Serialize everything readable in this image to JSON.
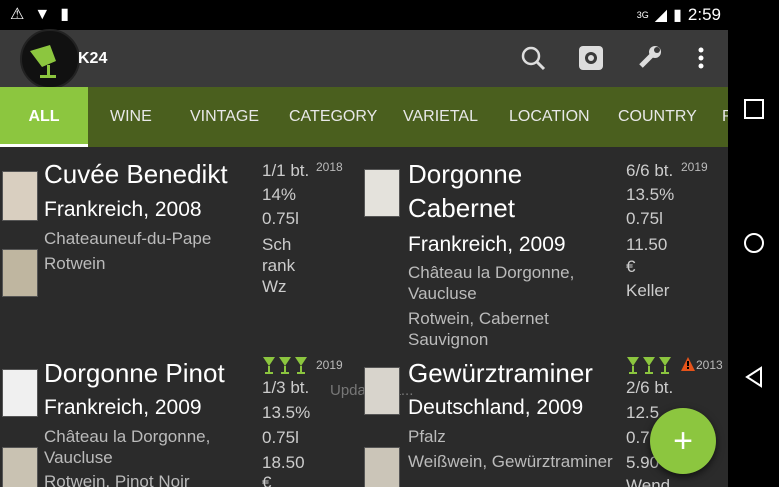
{
  "status": {
    "time": "2:59",
    "network": "3G",
    "icons": [
      "warning-icon",
      "wifi-icon",
      "sd-card-icon"
    ]
  },
  "appbar": {
    "title": "K24",
    "actions": [
      "search-icon",
      "settings-icon",
      "wrench-icon",
      "more-icon"
    ]
  },
  "tabs": [
    {
      "label": "ALL"
    },
    {
      "label": "WINE"
    },
    {
      "label": "VINTAGE"
    },
    {
      "label": "CATEGORY"
    },
    {
      "label": "VARIETAL"
    },
    {
      "label": "LOCATION"
    },
    {
      "label": "COUNTRY"
    },
    {
      "label": "R"
    }
  ],
  "ghost_text": "UpdateSta...",
  "cards": [
    {
      "title": "Cuvée Benedikt",
      "subtitle": "Frankreich, 2008",
      "region": "Chateauneuf-du-Pape",
      "type": "Rotwein",
      "bottles": "1/1 bt.",
      "year": "2018",
      "alcohol": "14%",
      "volume": "0.75l",
      "location1": "Sch",
      "location2": "rank",
      "location3": "Wz"
    },
    {
      "title1": "Dorgonne",
      "title2": "Cabernet",
      "subtitle": "Frankreich, 2009",
      "region1": "Château la Dorgonne,",
      "region2": "Vaucluse",
      "type1": "Rotwein, Cabernet",
      "type2": "Sauvignon",
      "bottles": "6/6 bt.",
      "year": "2019",
      "alcohol": "13.5%",
      "volume": "0.75l",
      "price": "11.50",
      "currency": "€",
      "location": "Keller"
    },
    {
      "title": "Dorgonne Pinot",
      "subtitle": "Frankreich, 2009",
      "region1": "Château la Dorgonne,",
      "region2": "Vaucluse",
      "type": "Rotwein, Pinot Noir",
      "bottles": "1/3 bt.",
      "year": "2019",
      "alcohol": "13.5%",
      "volume": "0.75l",
      "price": "18.50",
      "currency": "€"
    },
    {
      "title": "Gewürztraminer",
      "subtitle": "Deutschland, 2009",
      "region": "Pfalz",
      "type": "Weißwein, Gewürztraminer",
      "bottles": "2/6 bt.",
      "year": "2013",
      "alcohol": "12.5",
      "volume": "0.7",
      "price": "5.90",
      "location": "Wend"
    }
  ],
  "fab_label": "+",
  "colors": {
    "accent": "#8cc63f",
    "tabbar": "#4a5f1e",
    "appbar": "#3a3a3a",
    "background": "#2b2b2b",
    "warning": "#e6531a"
  }
}
